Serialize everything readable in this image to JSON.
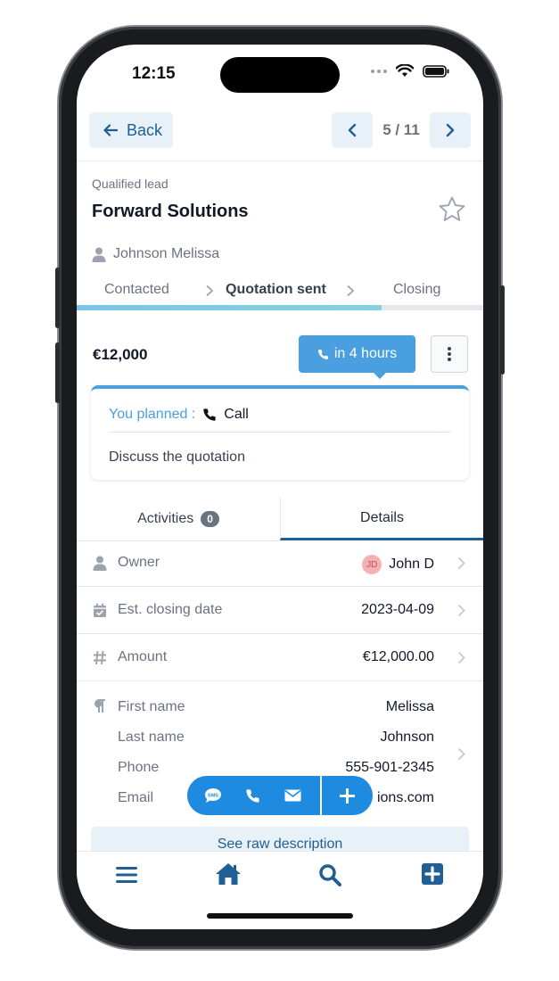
{
  "status_bar": {
    "time": "12:15"
  },
  "nav": {
    "back_label": "Back",
    "pager": "5 / 11"
  },
  "lead": {
    "type": "Qualified lead",
    "title": "Forward Solutions",
    "contact": "Johnson Melissa"
  },
  "pipeline": {
    "stages": [
      "Contacted",
      "Quotation sent",
      "Closing"
    ],
    "active_index": 1,
    "progress_fraction": 0.75
  },
  "deal": {
    "amount": "€12,000",
    "next_activity": "in 4 hours"
  },
  "activity": {
    "planned_label": "You planned :",
    "type": "Call",
    "description": "Discuss the quotation"
  },
  "tabs": {
    "activities_label": "Activities",
    "activities_count": "0",
    "details_label": "Details"
  },
  "details": {
    "owner_label": "Owner",
    "owner_initials": "JD",
    "owner_value": "John D",
    "closing_label": "Est. closing date",
    "closing_value": "2023-04-09",
    "amount_label": "Amount",
    "amount_value": "€12,000.00"
  },
  "description": {
    "first_name_label": "First name",
    "first_name": "Melissa",
    "last_name_label": "Last name",
    "last_name": "Johnson",
    "phone_label": "Phone",
    "phone": "555-901-2345",
    "email_label": "Email",
    "email": "ions.com"
  },
  "raw_button": "See raw description",
  "fab": {
    "sms_label": "SMS"
  },
  "colors": {
    "primary": "#1f5f93",
    "accent": "#4a9fe0",
    "fab": "#1f8be0",
    "light_button": "#e8f0f8"
  },
  "icons": [
    "arrow-left-icon",
    "chevron-left-icon",
    "chevron-right-icon",
    "star-icon",
    "user-icon",
    "phone-icon",
    "more-vertical-icon",
    "calendar-check-icon",
    "hash-icon",
    "paragraph-icon",
    "sms-icon",
    "envelope-icon",
    "plus-icon",
    "menu-icon",
    "home-icon",
    "search-icon",
    "plus-square-icon"
  ]
}
